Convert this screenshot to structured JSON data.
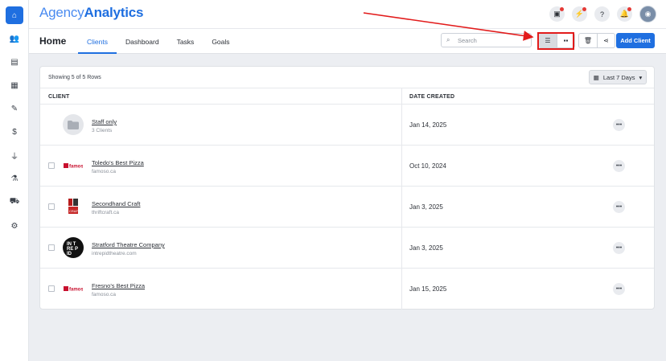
{
  "brand": {
    "part1": "Agency",
    "part2": "Analytics"
  },
  "sidebar": {
    "items": [
      {
        "icon": "home-icon",
        "glyph": "⌂",
        "active": true
      },
      {
        "icon": "users-icon",
        "glyph": "👥",
        "active": false
      },
      {
        "icon": "report-icon",
        "glyph": "▤",
        "active": false
      },
      {
        "icon": "dashboards-icon",
        "glyph": "▦",
        "active": false
      },
      {
        "icon": "tasks-icon",
        "glyph": "✎",
        "active": false
      },
      {
        "icon": "billing-icon",
        "glyph": "$",
        "active": false
      },
      {
        "icon": "integrations-icon",
        "glyph": "⏚",
        "active": false
      },
      {
        "icon": "labs-icon",
        "glyph": "⚗",
        "active": false
      },
      {
        "icon": "marketplace-icon",
        "glyph": "⛟",
        "active": false
      },
      {
        "icon": "settings-icon",
        "glyph": "⚙",
        "active": false
      }
    ]
  },
  "topbar": {
    "icons": [
      {
        "name": "media-icon",
        "glyph": "▣"
      },
      {
        "name": "whats-new-icon",
        "glyph": "⚡"
      },
      {
        "name": "help-icon",
        "glyph": "?"
      },
      {
        "name": "notifications-icon",
        "glyph": "🔔"
      }
    ]
  },
  "header": {
    "title": "Home",
    "tabs": [
      {
        "label": "Clients",
        "active": true
      },
      {
        "label": "Dashboard",
        "active": false
      },
      {
        "label": "Tasks",
        "active": false
      },
      {
        "label": "Goals",
        "active": false
      }
    ],
    "search_placeholder": "Search",
    "add_button": "Add Client"
  },
  "table": {
    "showing": "Showing 5 of 5 Rows",
    "range": "Last 7 Days",
    "col_client": "CLIENT",
    "col_date": "DATE CREATED",
    "rows": [
      {
        "name": "Staff only",
        "sub": "3 Clients",
        "date": "Jan 14, 2025",
        "logo": "folder"
      },
      {
        "name": "Toledo's Best Pizza",
        "sub": "famoso.ca",
        "date": "Oct 10, 2024",
        "logo": "famoso"
      },
      {
        "name": "Secondhand Craft",
        "sub": "thriftcraft.ca",
        "date": "Jan 3, 2025",
        "logo": "thrift"
      },
      {
        "name": "Stratford Theatre Company",
        "sub": "intrepidtheatre.com",
        "date": "Jan 3, 2025",
        "logo": "intrepid"
      },
      {
        "name": "Fresno's Best Pizza",
        "sub": "famoso.ca",
        "date": "Jan 15, 2025",
        "logo": "famoso"
      }
    ]
  },
  "colors": {
    "accent": "#1f6fe0",
    "highlight": "#e21b1b"
  }
}
